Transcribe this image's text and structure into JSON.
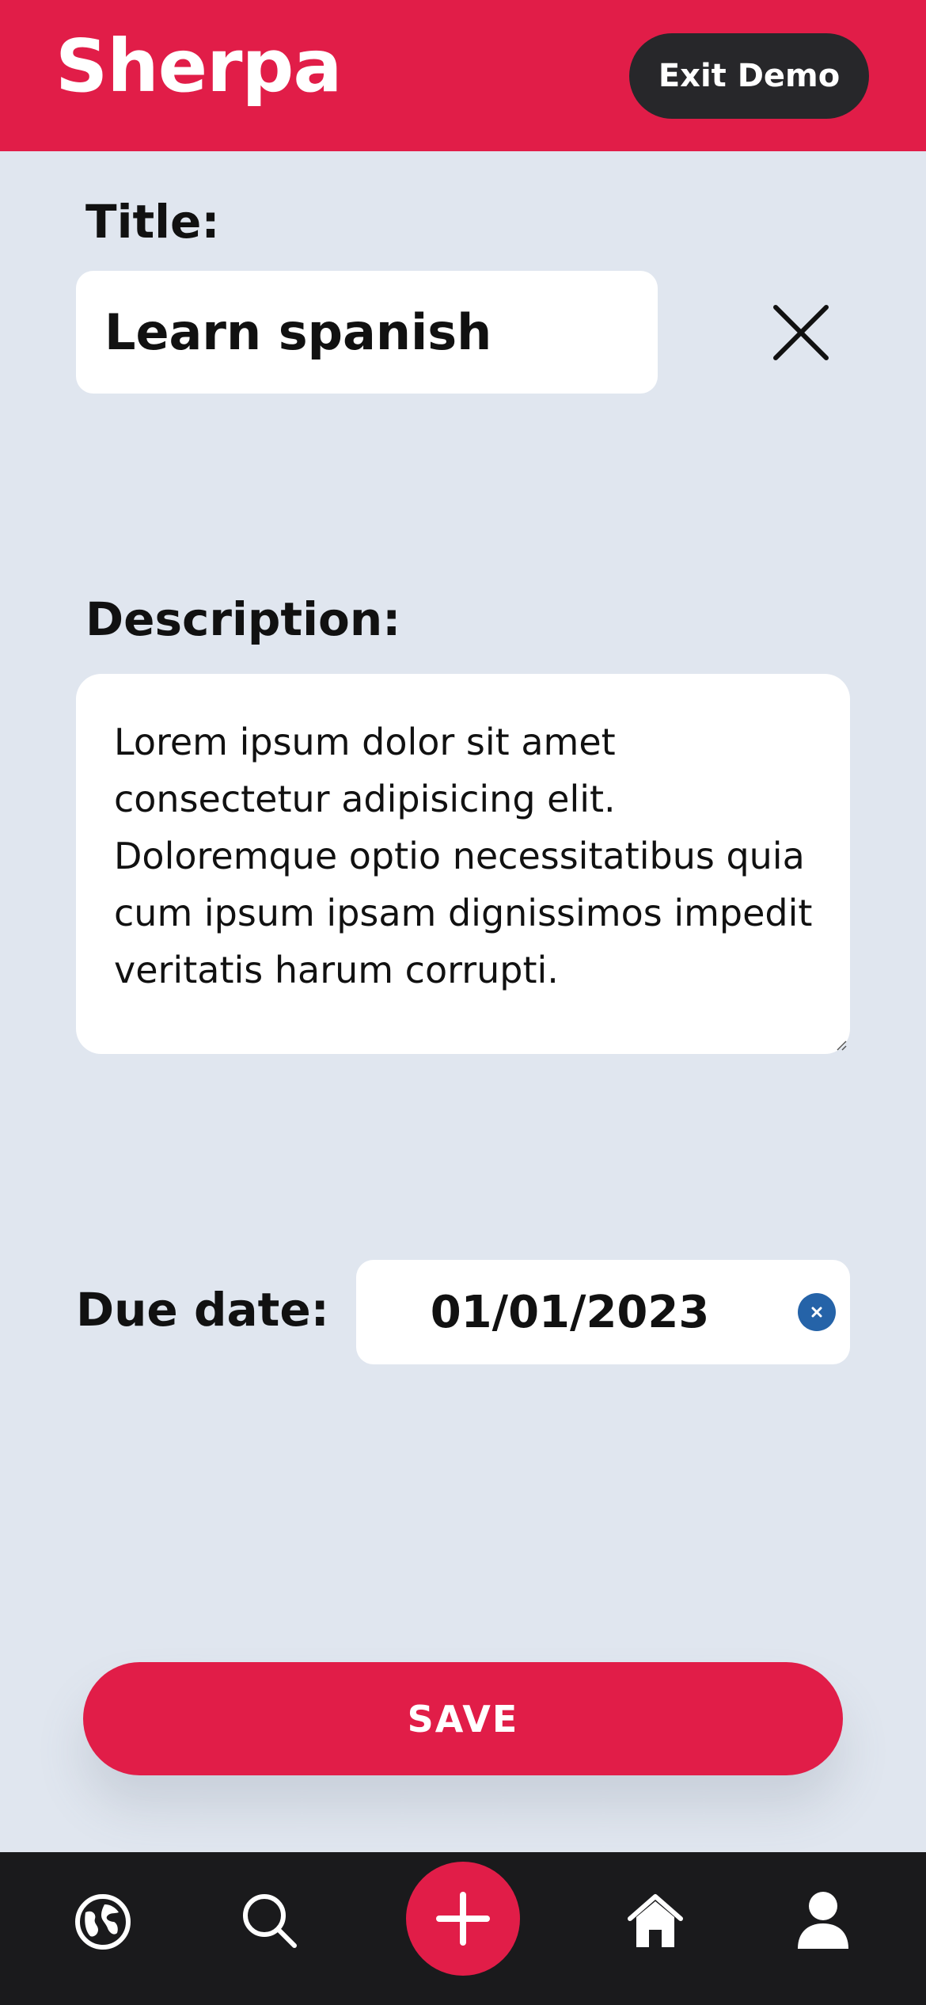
{
  "header": {
    "app_name": "Sherpa",
    "exit_label": "Exit Demo"
  },
  "form": {
    "title_label": "Title:",
    "title_value": "Learn spanish",
    "description_label": "Description:",
    "description_value": "Lorem ipsum dolor sit amet consectetur adipisicing elit. Doloremque optio necessitatibus quia cum ipsum ipsam dignissimos impedit veritatis harum corrupti.",
    "due_date_label": "Due date:",
    "due_date_value": "01/01/2023",
    "save_label": "SAVE"
  },
  "colors": {
    "brand": "#e11d48",
    "background": "#e0e6ef",
    "nav_background": "#1a1a1c",
    "exit_button": "#27272a",
    "date_clear": "#2563a8"
  },
  "icons": {
    "close": "close-icon",
    "date_clear": "clear-date-icon",
    "nav": [
      "globe-icon",
      "search-icon",
      "plus-icon",
      "home-icon",
      "user-icon"
    ]
  }
}
